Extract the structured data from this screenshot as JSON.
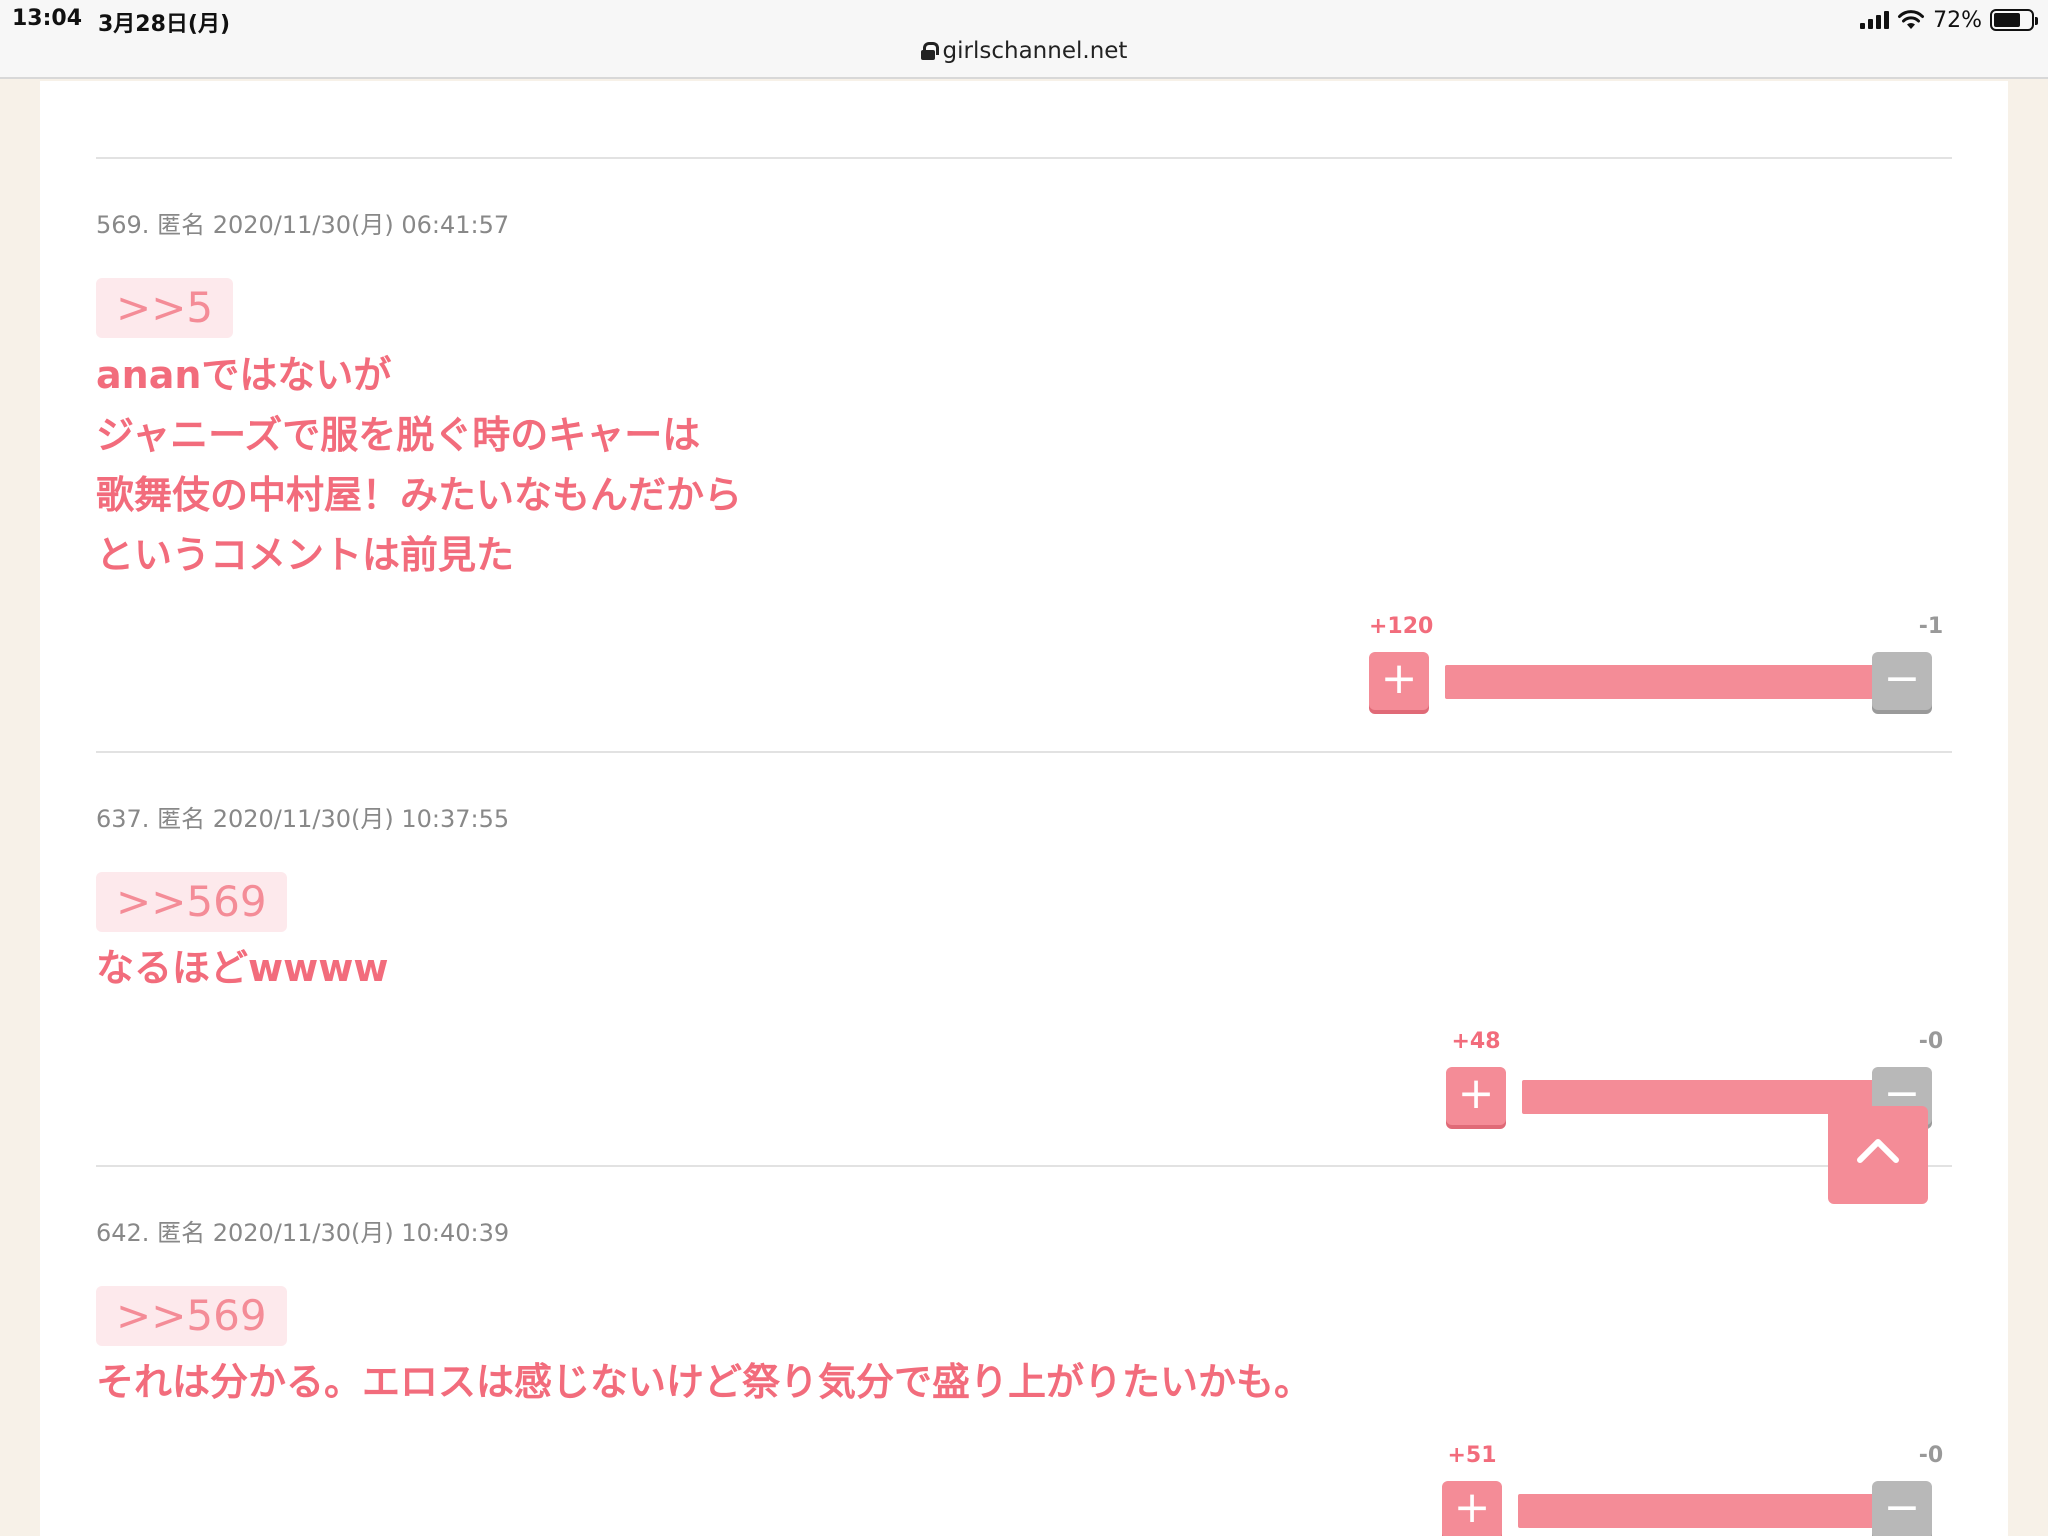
{
  "status": {
    "time": "13:04",
    "date": "3月28日(月)",
    "battery": "72%",
    "battery_level": 0.72
  },
  "address": {
    "url": "girlschannel.net"
  },
  "comments": [
    {
      "meta": "569. 匿名 2020/11/30(月) 06:41:57",
      "anchor": ">>5",
      "body": "ananではないが\nジャニーズで服を脱ぐ時のキャーは\n歌舞伎の中村屋！みたいなもんだから\nというコメントは前見た",
      "plus": "+120",
      "minus": "-1",
      "ratio": 0.992
    },
    {
      "meta": "637. 匿名 2020/11/30(月) 10:37:55",
      "anchor": ">>569",
      "body": "なるほどwwww",
      "plus": "+48",
      "minus": "-0",
      "ratio": 1.0
    },
    {
      "meta": "642. 匿名 2020/11/30(月) 10:40:39",
      "anchor": ">>569",
      "body": "それは分かる。エロスは感じないけど祭り気分で盛り上がりたいかも。",
      "plus": "+51",
      "minus": "-0",
      "ratio": 1.0
    }
  ],
  "icons": {
    "plus": "plus-icon",
    "minus": "minus-icon",
    "scroll_top": "chevron-up-icon"
  },
  "colors": {
    "accent": "#f48c97",
    "body_text": "#f26c7c",
    "meta_text": "#888888"
  }
}
